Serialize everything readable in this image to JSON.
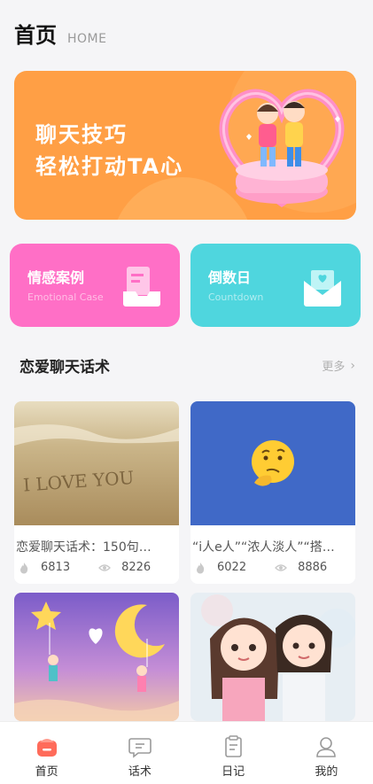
{
  "header": {
    "title": "首页",
    "subtitle": "HOME"
  },
  "banner": {
    "line1": "聊天技巧",
    "line2": "轻松打动TA心"
  },
  "cards": [
    {
      "title": "情感案例",
      "subtitle": "Emotional Case",
      "color": "#ff6fc6",
      "icon": "document-tray-icon"
    },
    {
      "title": "倒数日",
      "subtitle": "Countdown",
      "color": "#4fd6de",
      "icon": "mail-heart-icon"
    }
  ],
  "section": {
    "title": "恋爱聊天话术",
    "more": "更多"
  },
  "articles": [
    {
      "title": "恋爱聊天话术：150句…",
      "likes": "6813",
      "views": "8226"
    },
    {
      "title": "“i人e人”“浓人淡人”“搭…",
      "likes": "6022",
      "views": "8886"
    }
  ],
  "tabs": [
    {
      "label": "首页",
      "icon": "home-icon",
      "active": true
    },
    {
      "label": "话术",
      "icon": "chat-icon",
      "active": false
    },
    {
      "label": "日记",
      "icon": "diary-icon",
      "active": false
    },
    {
      "label": "我的",
      "icon": "profile-icon",
      "active": false
    }
  ],
  "colors": {
    "accent": "#ff9f45",
    "tab_active": "#ff6b5a"
  }
}
